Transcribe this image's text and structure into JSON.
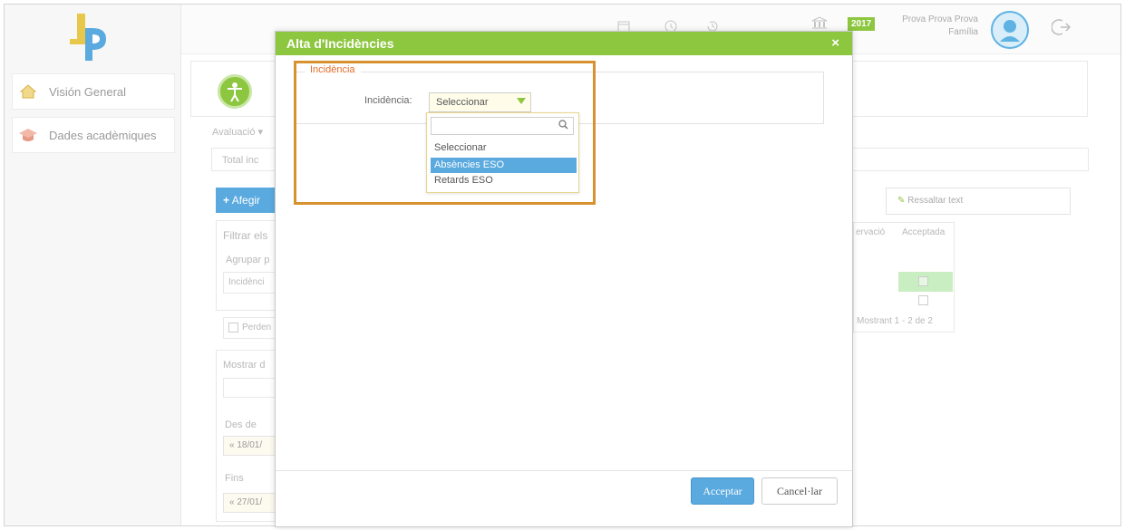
{
  "sidebar": {
    "items": [
      {
        "label": "Visión General",
        "icon": "home-icon"
      },
      {
        "label": "Dades acadèmiques",
        "icon": "graduation-cap-icon"
      }
    ]
  },
  "topbar": {
    "year": "2017",
    "user_name_line1": "Prova Prova Prova",
    "user_name_line2": "Família"
  },
  "background": {
    "evaluacio": "Avaluació",
    "total_inc": "Total inc",
    "add_button": "Afegir",
    "filter_label": "Filtrar els",
    "group_label": "Agrupar p",
    "group_value": "Incidènci",
    "perdent": "Perden",
    "mostrar": "Mostrar d",
    "des_de": "Des de",
    "des_de_value": "18/01/",
    "fins": "Fins",
    "fins_value": "27/01/",
    "ressaltar": "Ressaltar text",
    "col_observacio": "ervació",
    "col_acceptada": "Acceptada",
    "pagination": "Mostrant 1 - 2 de 2"
  },
  "modal": {
    "title": "Alta d'Incidències",
    "close": "×",
    "fieldset_legend": "Incidència",
    "field_label": "Incidència:",
    "select_value": "Seleccionar",
    "search_value": "",
    "options": [
      "Seleccionar",
      "Absències ESO",
      "Retards ESO"
    ],
    "active_option_index": 1,
    "accept_button": "Acceptar",
    "cancel_button": "Cancel·lar"
  },
  "colors": {
    "accent_green": "#8dc63f",
    "accent_blue": "#5aa9df",
    "highlight_orange": "#d7922f",
    "legend_orange": "#e26e2b"
  }
}
